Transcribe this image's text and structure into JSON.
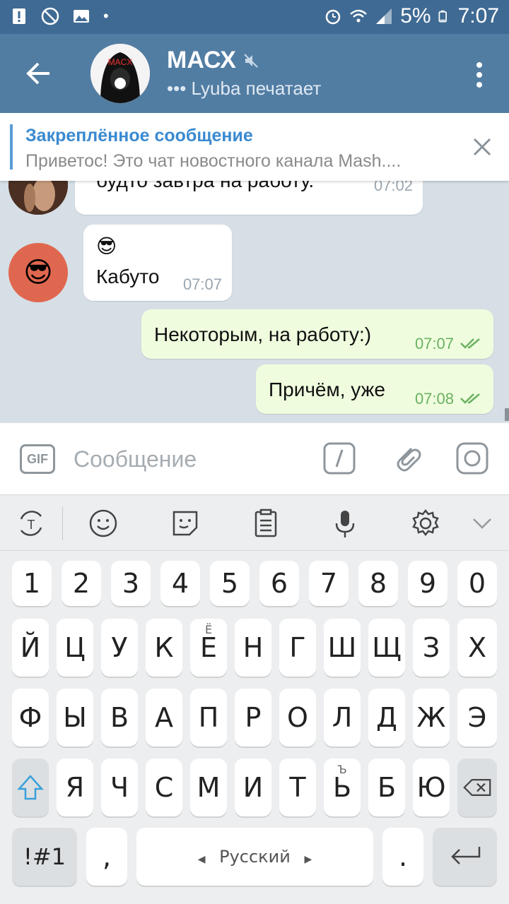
{
  "status_bar": {
    "battery": "5%",
    "time": "7:07"
  },
  "header": {
    "title": "МАСХ",
    "subtitle": "••• Lyuba печатает",
    "avatar_text": "MACX"
  },
  "pinned": {
    "title": "Закреплённое сообщение",
    "text": "Приветос! Это чат новостного канала Mash...."
  },
  "messages": [
    {
      "text": "будто завтра на работу.",
      "time": "07:02",
      "direction": "in"
    },
    {
      "emoji": "😎",
      "text": "Кабуто",
      "time": "07:07",
      "direction": "in"
    },
    {
      "text": "Некоторым, на работу:)",
      "time": "07:07",
      "direction": "out"
    },
    {
      "text": "Причём, уже",
      "time": "07:08",
      "direction": "out"
    }
  ],
  "input": {
    "gif_label": "GIF",
    "placeholder": "Сообщение"
  },
  "keyboard": {
    "row_numbers": [
      "1",
      "2",
      "3",
      "4",
      "5",
      "6",
      "7",
      "8",
      "9",
      "0"
    ],
    "row1": [
      "Й",
      "Ц",
      "У",
      "К",
      "Е",
      "Н",
      "Г",
      "Ш",
      "Щ",
      "З",
      "Х"
    ],
    "row1_sub_e": "Ё",
    "row2": [
      "Ф",
      "Ы",
      "В",
      "А",
      "П",
      "Р",
      "О",
      "Л",
      "Д",
      "Ж",
      "Э"
    ],
    "row3": [
      "Я",
      "Ч",
      "С",
      "М",
      "И",
      "Т",
      "Ь",
      "Б",
      "Ю"
    ],
    "row3_sub_soft": "Ъ",
    "symbols_label": "!#1",
    "comma": ",",
    "space_label": "Русский",
    "period": "."
  },
  "colors": {
    "header": "#527da3",
    "statusbar": "#3f6a93",
    "accent": "#3a8ad0",
    "outgoing_bubble": "#effdde"
  }
}
